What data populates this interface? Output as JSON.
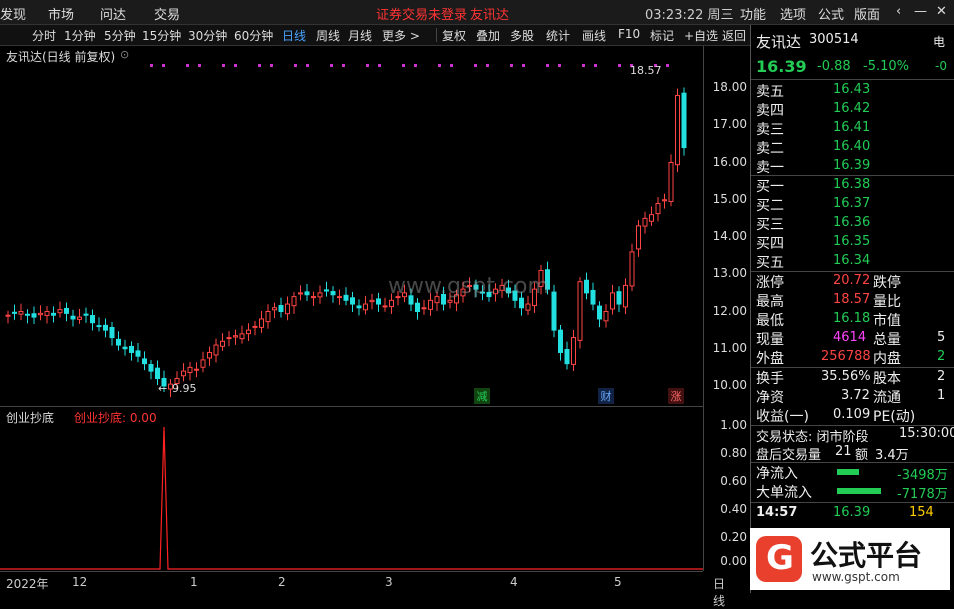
{
  "topbar": {
    "items": [
      "发现",
      "市场",
      "问达",
      "交易"
    ],
    "notice": "证券交易未登录",
    "app": "友讯达",
    "time": "03:23:22 周三",
    "right_menu": [
      "功能",
      "选项",
      "公式",
      "版面"
    ]
  },
  "toolbar": {
    "periods": [
      "分时",
      "1分钟",
      "5分钟",
      "15分钟",
      "30分钟",
      "60分钟",
      "日线",
      "周线",
      "月线",
      "更多 >"
    ],
    "tools": [
      "复权",
      "叠加",
      "多股",
      "统计",
      "画线",
      "F10",
      "标记",
      "+自选",
      "返回"
    ]
  },
  "chart_header": {
    "title": "友讯达(日线 前复权)",
    "high_marker": "18.57",
    "low_marker": "9.95",
    "markers": {
      "jian": "减",
      "cai": "财",
      "zhang": "涨"
    }
  },
  "indicator": {
    "name": "创业抄底",
    "value_label": "创业抄底: 0.00"
  },
  "time_axis": [
    "2022年",
    "12",
    "1",
    "2",
    "3",
    "4",
    "5",
    "日线"
  ],
  "price_axis": [
    "18.00",
    "17.00",
    "16.00",
    "15.00",
    "14.00",
    "13.00",
    "12.00",
    "11.00",
    "10.00"
  ],
  "sub_axis": [
    "1.00",
    "0.80",
    "0.60",
    "0.40",
    "0.20",
    "0.00"
  ],
  "quote": {
    "name": "友讯达",
    "code": "300514",
    "price": "16.39",
    "change": "-0.88",
    "pct": "-5.10%",
    "side_label": "电",
    "side_value": "-0"
  },
  "order_book": {
    "sell": [
      {
        "label": "卖五",
        "price": "16.43"
      },
      {
        "label": "卖四",
        "price": "16.42"
      },
      {
        "label": "卖三",
        "price": "16.41"
      },
      {
        "label": "卖二",
        "price": "16.40"
      },
      {
        "label": "卖一",
        "price": "16.39"
      }
    ],
    "buy": [
      {
        "label": "买一",
        "price": "16.38"
      },
      {
        "label": "买二",
        "price": "16.37"
      },
      {
        "label": "买三",
        "price": "16.36"
      },
      {
        "label": "买四",
        "price": "16.35"
      },
      {
        "label": "买五",
        "price": "16.34"
      }
    ]
  },
  "stats": {
    "zt_label": "涨停",
    "zt": "20.72",
    "dt_label": "跌停",
    "high_label": "最高",
    "high": "18.57",
    "lb_label": "量比",
    "low_label": "最低",
    "low": "16.18",
    "sz_label": "市值",
    "vol_label": "现量",
    "vol": "4614",
    "zl_label": "总量",
    "zl_tail": "5",
    "wp_label": "外盘",
    "wp": "256788",
    "np_label": "内盘",
    "np_tail": "2",
    "hs_label": "换手",
    "hs": "35.56%",
    "gb_label": "股本",
    "gb_tail": "2",
    "jz_label": "净资",
    "jz": "3.72",
    "lt_label": "流通",
    "lt_tail": "1",
    "sy_label": "收益(一)",
    "sy": "0.109",
    "pe_label": "PE(动)"
  },
  "trade_status": {
    "label": "交易状态: 闭市阶段",
    "time": "15:30:00",
    "after": "盘后交易量",
    "after_vol": "21",
    "after_amt_label": "额",
    "after_amt": "3.4万"
  },
  "flows": {
    "net_label": "净流入",
    "net": "-3498万",
    "big_label": "大单流入",
    "big": "-7178万"
  },
  "ticks": [
    {
      "time": "14:57",
      "price": "16.39",
      "vol": "154"
    }
  ],
  "chart_watermark": "www.gspt.com",
  "logo": {
    "text": "公式平台",
    "url": "www.gspt.com"
  },
  "colors": {
    "up": "#ff4444",
    "down": "#22e0e0",
    "bg": "#000000",
    "accent": "#4aa3ff"
  }
}
